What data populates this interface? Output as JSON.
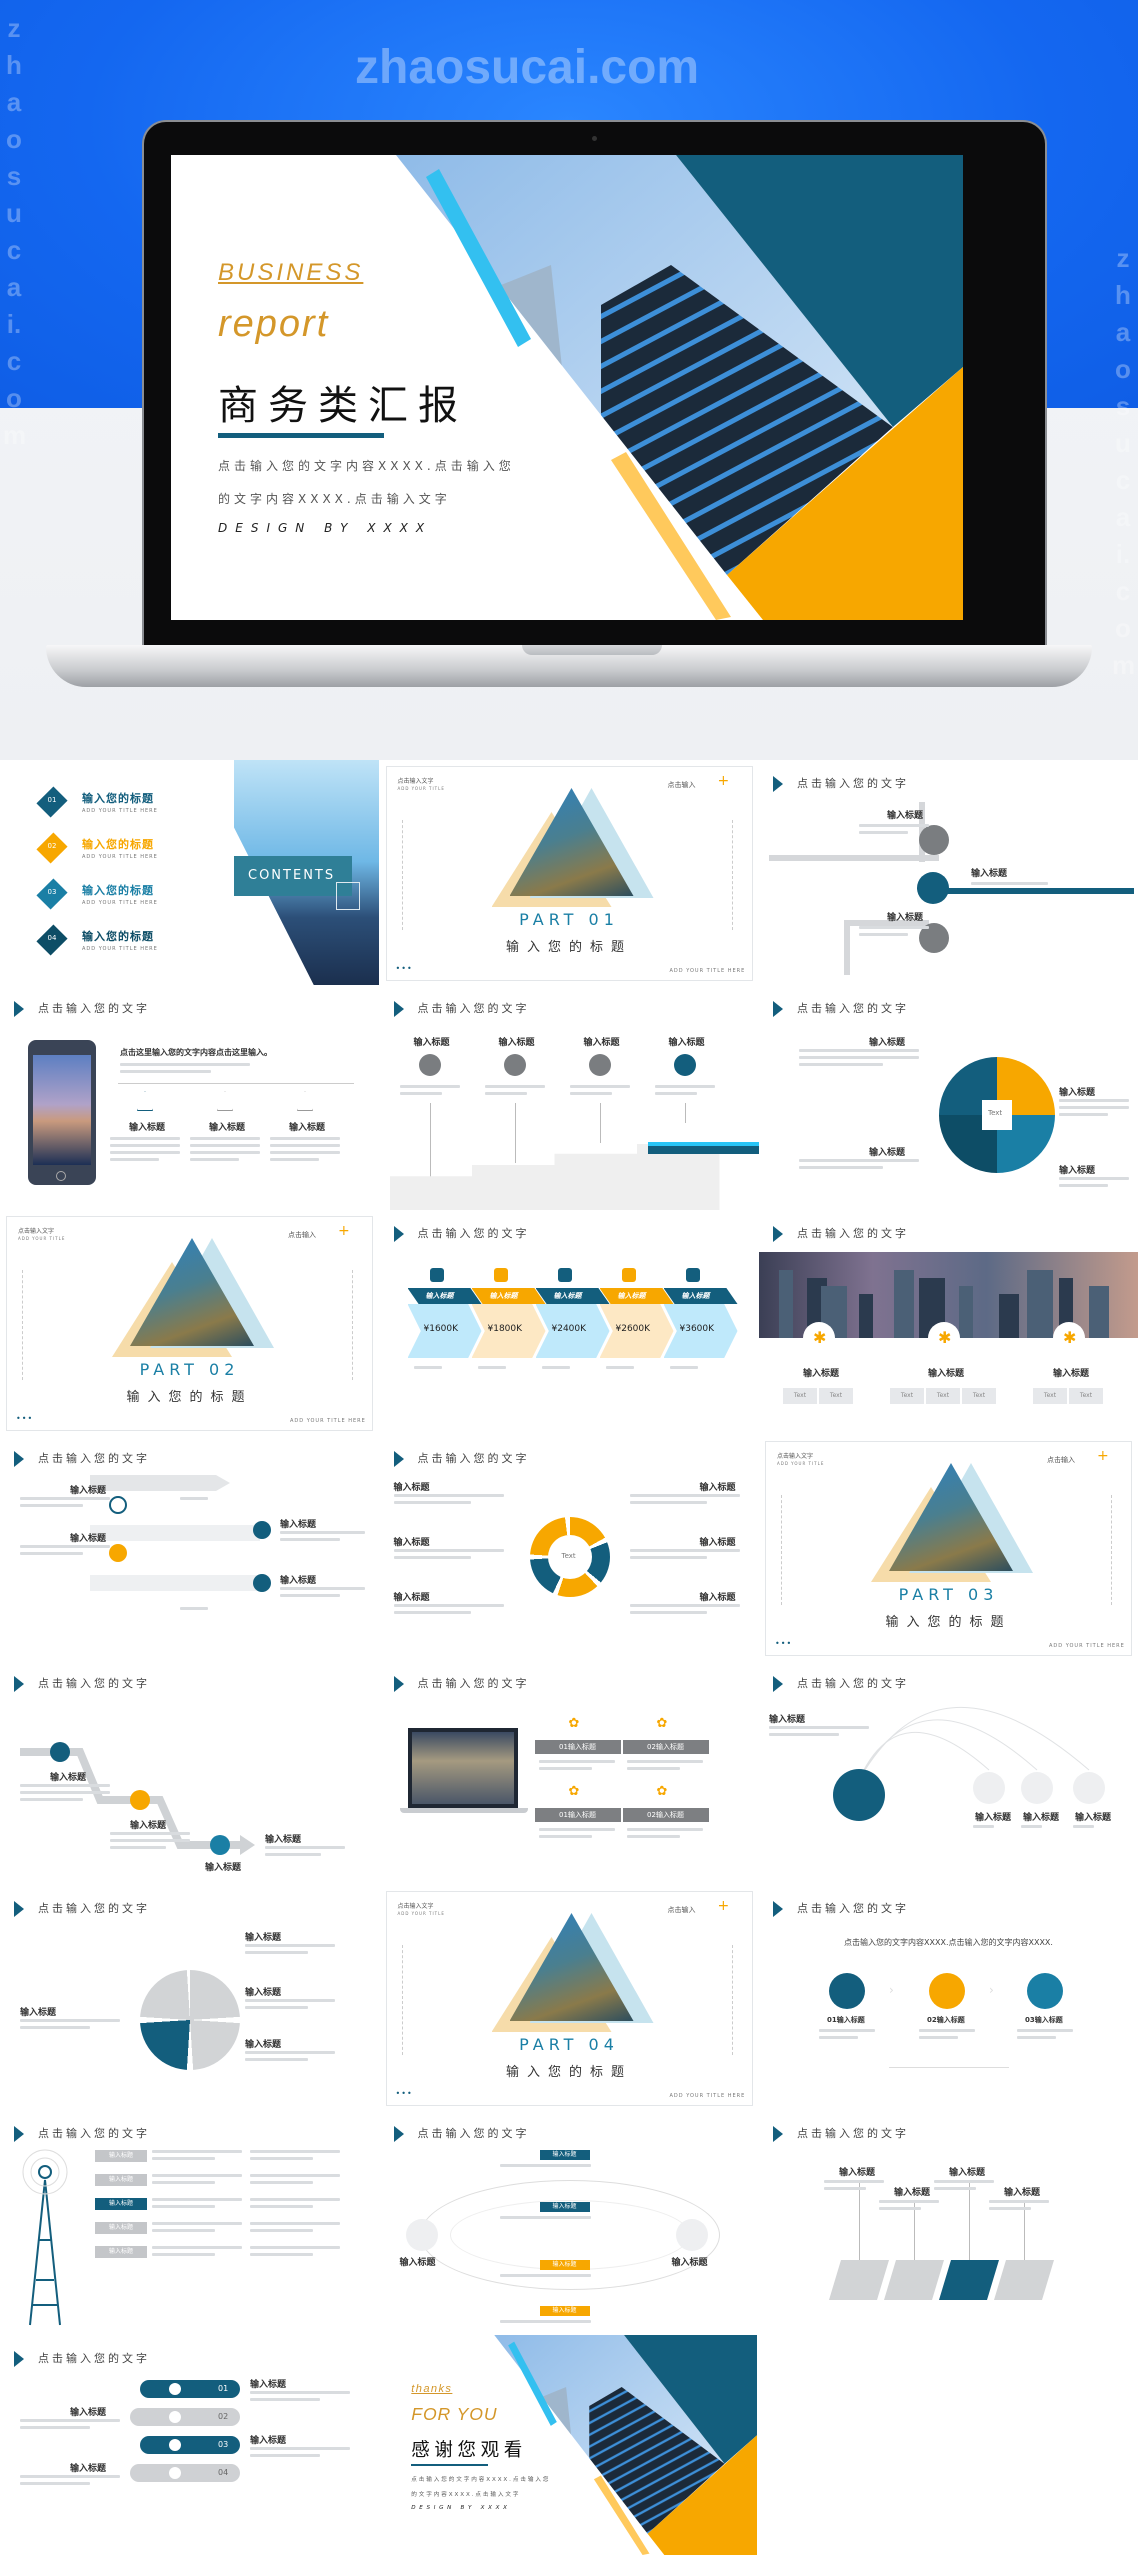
{
  "watermark": "zhaosucai.com",
  "side_watermark": "zhaosucai.com",
  "colors": {
    "teal": "#135e7d",
    "orange": "#f7a700",
    "blue": "#1a7fa5",
    "light_blue": "#4fc3f7",
    "hero_blue": "#1467f0"
  },
  "cover": {
    "business": "BUSINESS",
    "report": "report",
    "title": "商务类汇报",
    "desc1": "点击输入您的文字内容XXXX.点击输入您",
    "desc2": "的文字内容XXXX.点击输入文字",
    "design": "DESIGN BY XXXX"
  },
  "slide_header": "点击输入您的文字",
  "item_title": "输入标题",
  "text_label": "Text",
  "contents": {
    "label": "CONTENTS",
    "items": [
      {
        "num": "01",
        "title": "输入您的标题",
        "sub": "ADD YOUR TITLE HERE"
      },
      {
        "num": "02",
        "title": "输入您的标题",
        "sub": "ADD YOUR TITLE HERE"
      },
      {
        "num": "03",
        "title": "输入您的标题",
        "sub": "ADD YOUR TITLE HERE"
      },
      {
        "num": "04",
        "title": "输入您的标题",
        "sub": "ADD YOUR TITLE HERE"
      }
    ]
  },
  "part_common": {
    "top_left": "点击输入文字",
    "top_left_sub": "ADD YOUR TITLE",
    "top_right": "点击输入",
    "plus": "+",
    "bottom": "ADD YOUR TITLE HERE"
  },
  "parts": [
    {
      "part": "PART 01",
      "title": "输入您的标题"
    },
    {
      "part": "PART 02",
      "title": "输入您的标题"
    },
    {
      "part": "PART 03",
      "title": "输入您的标题"
    },
    {
      "part": "PART 04",
      "title": "输入您的标题"
    }
  ],
  "phone_headline": "点击这里输入您的文字内容点击这里输入。",
  "price": {
    "values": [
      "¥1600K",
      "¥1800K",
      "¥2400K",
      "¥2600K",
      "¥3600K"
    ]
  },
  "city_cells": [
    [
      "Text",
      "Text"
    ],
    [
      "Text",
      "Text",
      "Text"
    ],
    [
      "Text",
      "Text"
    ]
  ],
  "laptop_items": [
    "01输入标题",
    "02输入标题",
    "01输入标题",
    "02输入标题"
  ],
  "three_steps": {
    "headline": "点击输入您的文字内容XXXX.点击输入您的文字内容XXXX.",
    "items": [
      "01输入标题",
      "02输入标题",
      "03输入标题"
    ]
  },
  "list_nums": [
    "01",
    "02",
    "03",
    "04"
  ],
  "thanks": {
    "thanks": "thanks",
    "for_you": "FOR YOU",
    "title": "感谢您观看",
    "desc1": "点击输入您的文字内容XXXX.点击输入您",
    "desc2": "的文字内容XXXX.点击输入文字",
    "design": "DESIGN BY XXXX"
  }
}
